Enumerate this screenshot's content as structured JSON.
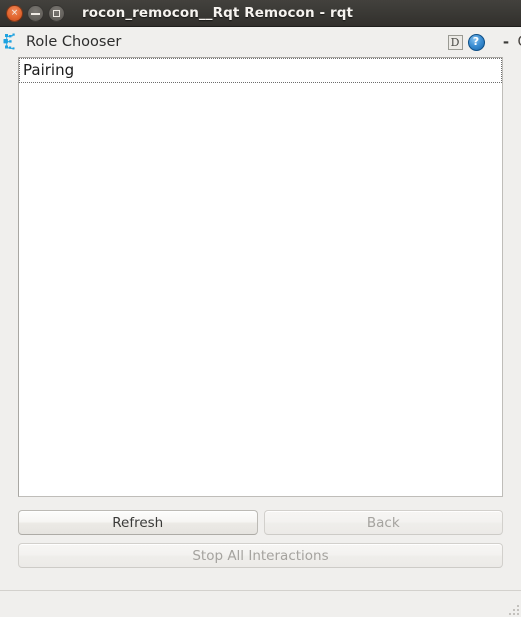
{
  "window": {
    "title": "rocon_remocon__Rqt Remocon - rqt",
    "controls": {
      "close_label": "×",
      "minimize_label": "−",
      "maximize_label": "□",
      "close_name": "close",
      "minimize_name": "minimize",
      "maximize_name": "maximize"
    }
  },
  "dock": {
    "title": "Role Chooser",
    "icon_name": "rocon-node-icon",
    "actions": {
      "detach_label": "D",
      "help_label": "?",
      "minimize_label": "-",
      "close_label": "O"
    }
  },
  "role_list": {
    "items": [
      {
        "label": "Pairing",
        "selected": true
      }
    ]
  },
  "buttons": {
    "refresh": {
      "label": "Refresh",
      "enabled": true
    },
    "back": {
      "label": "Back",
      "enabled": false
    },
    "stop_all": {
      "label": "Stop All Interactions",
      "enabled": false
    }
  },
  "statusbar": {
    "text": "",
    "sizegrip": "size-grip"
  },
  "colors": {
    "titlebar_top": "#43413d",
    "titlebar_bottom": "#322f2c",
    "window_bg": "#f0efed",
    "list_bg": "#ffffff",
    "close_button": "#e2662f",
    "help_icon": "#3f90d4",
    "text": "#2d2d2d",
    "disabled_text": "#a5a39f"
  }
}
